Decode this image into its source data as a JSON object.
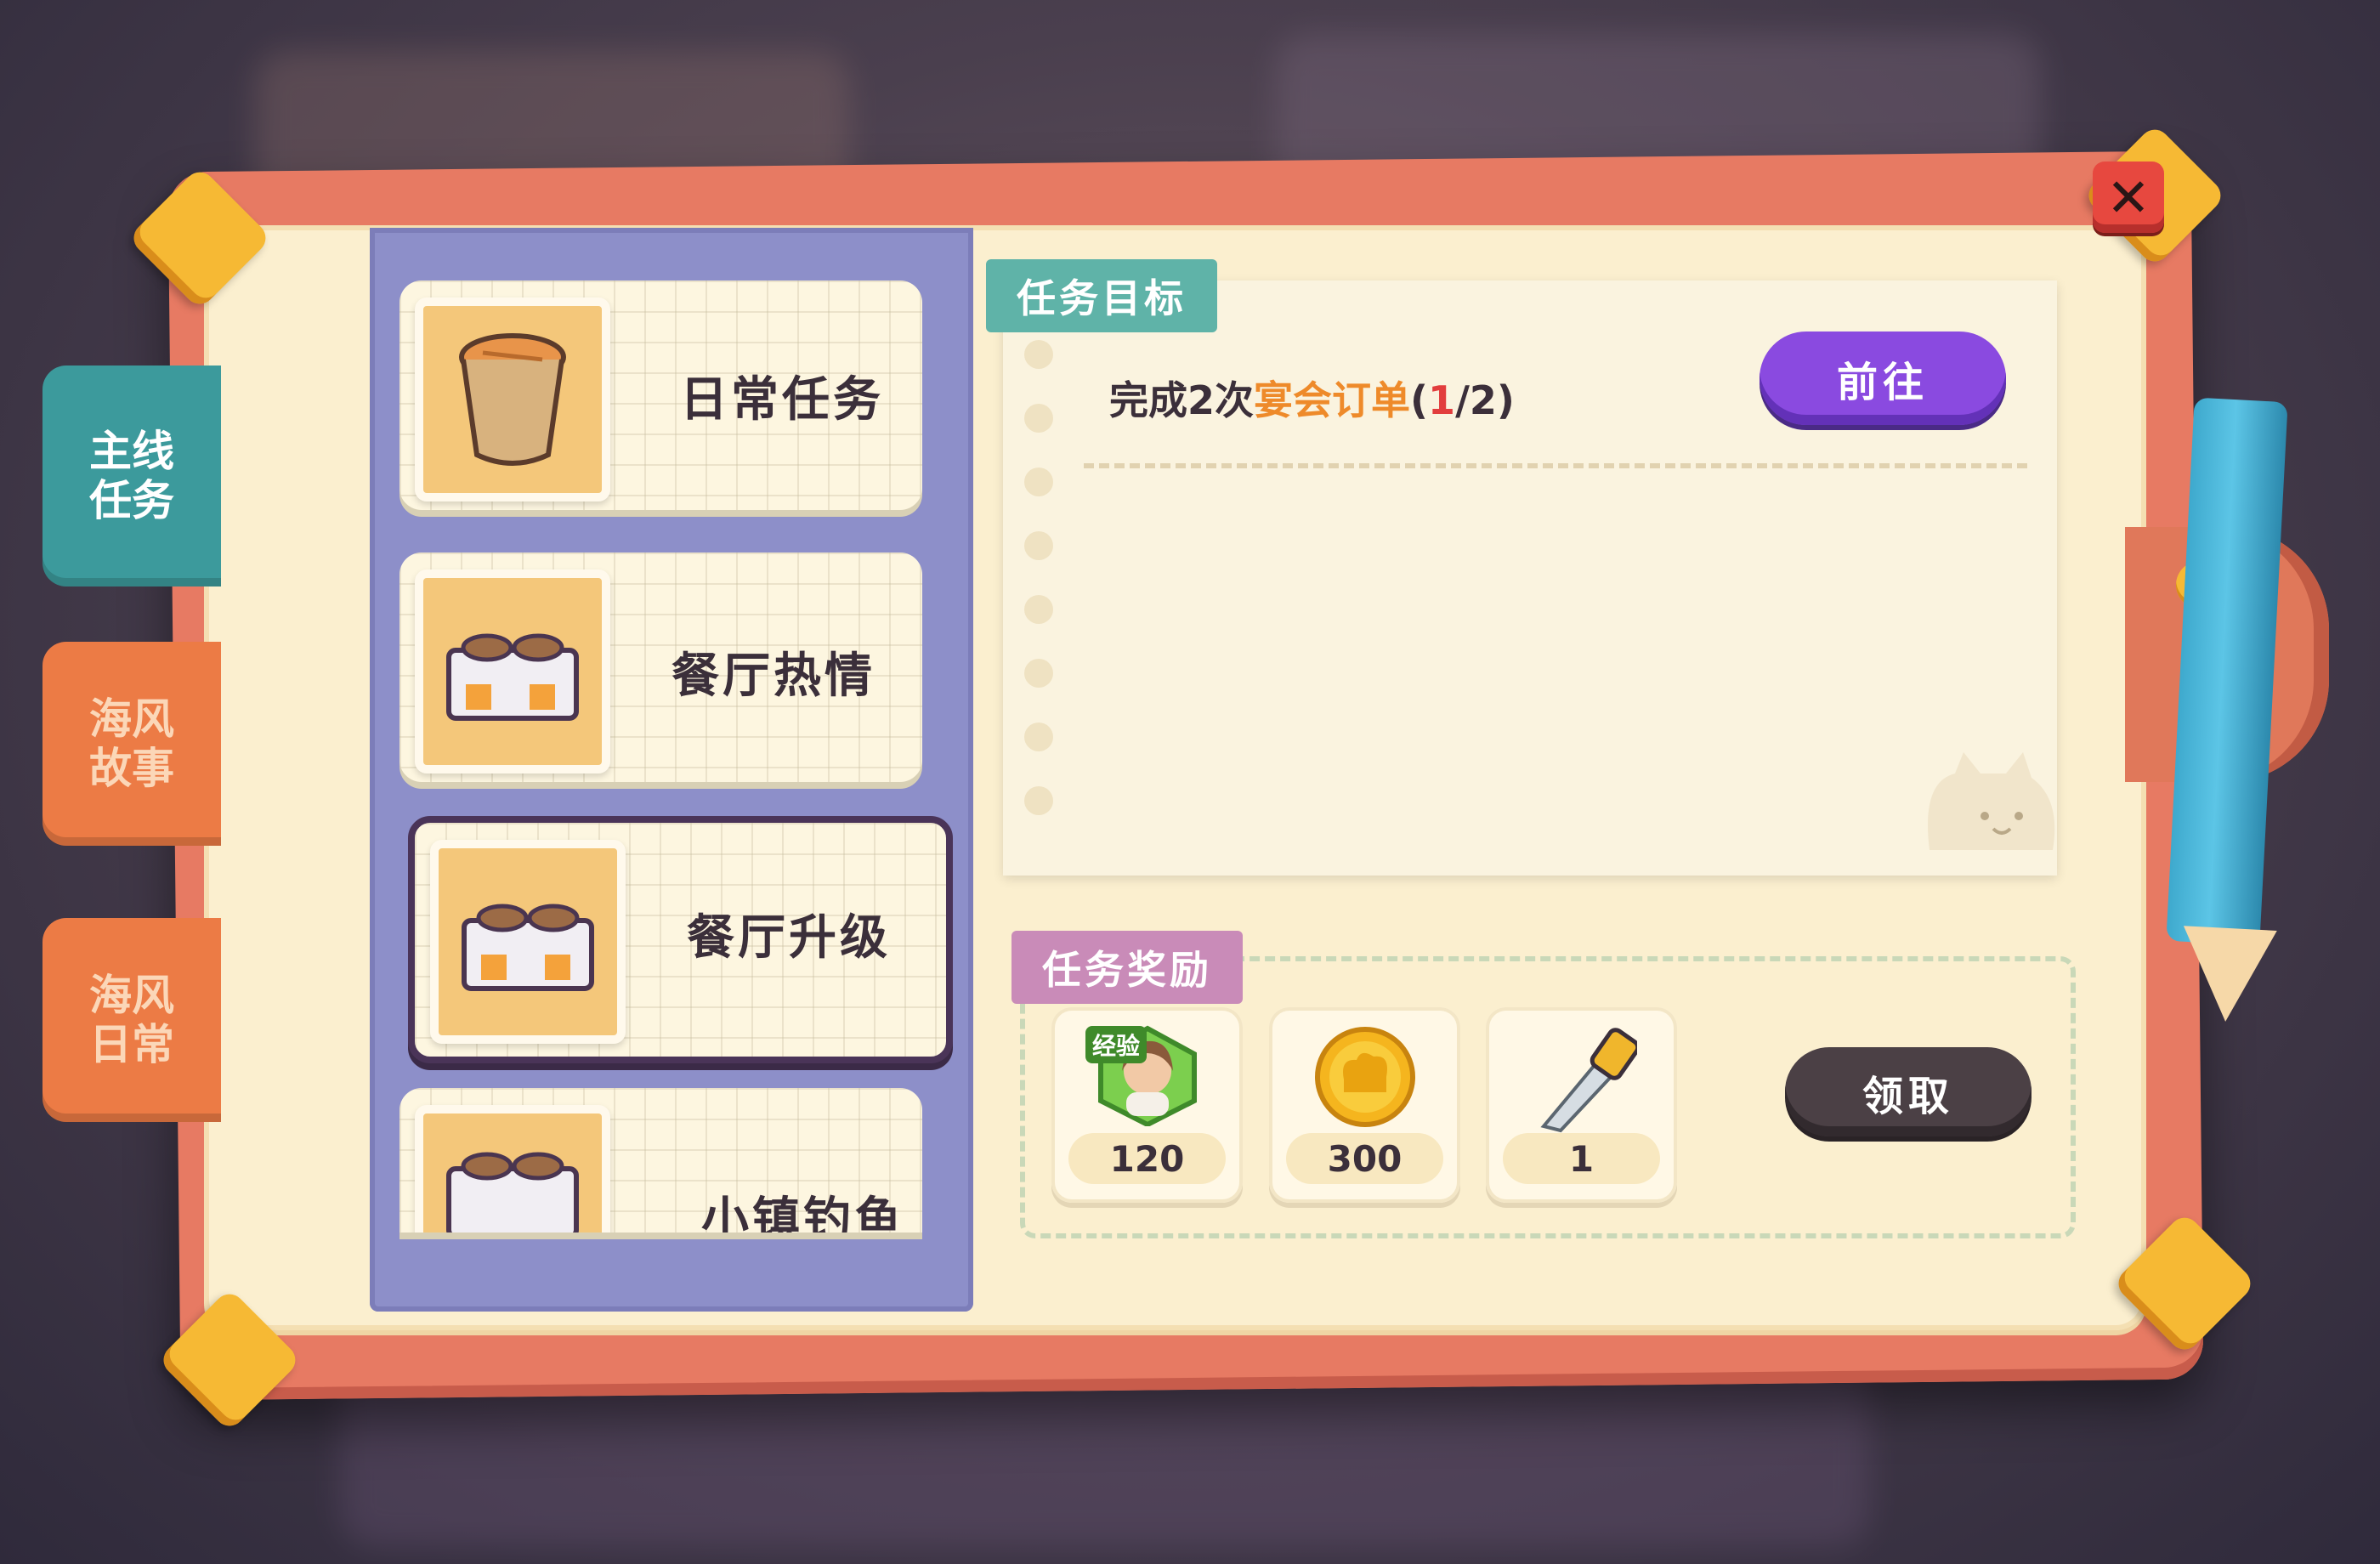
{
  "close": {
    "label": "✕"
  },
  "side_tabs": [
    {
      "label_line1": "主线",
      "label_line2": "任务",
      "active": true
    },
    {
      "label_line1": "海风",
      "label_line2": "故事",
      "active": false
    },
    {
      "label_line1": "海风",
      "label_line2": "日常",
      "active": false
    }
  ],
  "quest_list": [
    {
      "title": "日常任务",
      "icon": "bucket-icon"
    },
    {
      "title": "餐厅热情",
      "icon": "stove-icon"
    },
    {
      "title": "餐厅升级",
      "icon": "stove-icon",
      "selected": true
    },
    {
      "title": "小镇钓鱼",
      "icon": "stove-icon"
    }
  ],
  "objective": {
    "header": "任务目标",
    "text_prefix": "完成2次",
    "text_highlight": "宴会订单",
    "progress_open": "(",
    "progress_current": "1",
    "progress_rest": "/2)",
    "go_button": "前往"
  },
  "rewards": {
    "header": "任务奖励",
    "items": [
      {
        "badge": "经验",
        "count": "120",
        "icon": "experience-avatar-icon"
      },
      {
        "count": "300",
        "icon": "chef-coin-icon"
      },
      {
        "count": "1",
        "icon": "saw-icon"
      }
    ],
    "claim_button": "领取"
  },
  "colors": {
    "active_tab": "#3c9a9c",
    "inactive_tab": "#ec7b45",
    "go_button": "#8a4ae0",
    "claim_button": "#4b4045",
    "highlight": "#ee8a2a",
    "progress_current": "#e23d3d"
  }
}
